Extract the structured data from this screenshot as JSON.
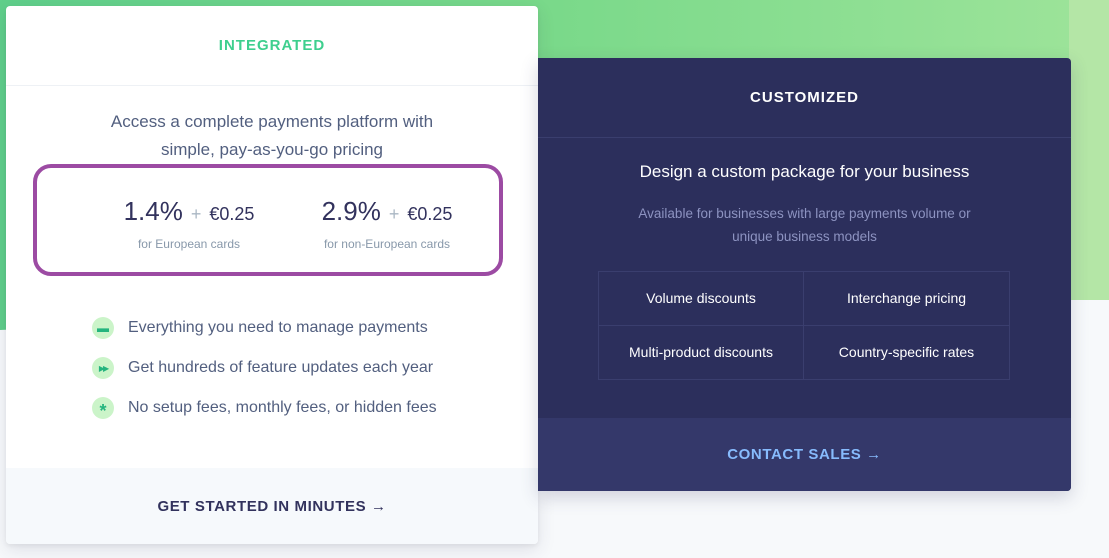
{
  "integrated": {
    "title": "INTEGRATED",
    "description": "Access a complete payments platform with simple, pay-as-you-go pricing",
    "prices": [
      {
        "percent": "1.4%",
        "plus": "+",
        "fee": "€0.25",
        "label": "for European cards"
      },
      {
        "percent": "2.9%",
        "plus": "+",
        "fee": "€0.25",
        "label": "for non-European cards"
      }
    ],
    "features": [
      {
        "icon": "cash-icon",
        "glyph": "▬",
        "text": "Everything you need to manage payments"
      },
      {
        "icon": "fast-forward-icon",
        "glyph": "▶▶",
        "text": "Get hundreds of feature updates each year"
      },
      {
        "icon": "star-icon",
        "glyph": "*",
        "text": "No setup fees, monthly fees, or hidden fees"
      }
    ],
    "cta": "GET STARTED IN MINUTES →"
  },
  "customized": {
    "title": "CUSTOMIZED",
    "description": "Design a custom package for your business",
    "subtext": "Available for businesses with large payments volume or unique business models",
    "options": [
      "Volume discounts",
      "Interchange pricing",
      "Multi-product discounts",
      "Country-specific rates"
    ],
    "cta": "CONTACT SALES →"
  },
  "colors": {
    "accent_green": "#3ecf8e",
    "dark_card": "#2c2f5c",
    "highlight_border": "#9c4ba3",
    "link_blue": "#87bbfd"
  }
}
